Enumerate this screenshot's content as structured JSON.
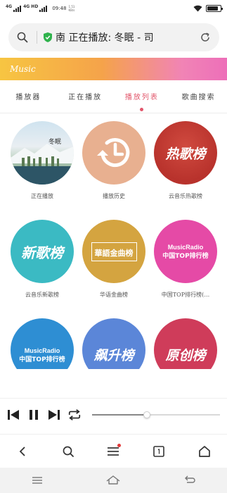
{
  "status_bar": {
    "network1": "4G",
    "network2": "4G HD",
    "time": "09:48",
    "speed_value": "1.51",
    "speed_unit": "KB/s"
  },
  "address_bar": {
    "url_text": "南 正在播放: 冬眠 - 司"
  },
  "banner": {
    "label": "Music"
  },
  "tabs": [
    {
      "label": "播放器",
      "active": false
    },
    {
      "label": "正在播放",
      "active": false
    },
    {
      "label": "播放列表",
      "active": true
    },
    {
      "label": "歌曲搜索",
      "active": false
    }
  ],
  "playlists": [
    {
      "caption": "正在播放",
      "art_text": "冬眠"
    },
    {
      "caption": "播放历史",
      "art_text": ""
    },
    {
      "caption": "云音乐热歌榜",
      "art_text": "热歌榜"
    },
    {
      "caption": "云音乐新歌榜",
      "art_text": "新歌榜"
    },
    {
      "caption": "华语金曲榜",
      "art_text": "華語金曲榜"
    },
    {
      "caption": "中国TOP排行榜(…",
      "art_text_top": "MusicRadio",
      "art_text_bottom": "中国TOP排行榜"
    },
    {
      "caption": "",
      "art_text_top": "MusicRadio",
      "art_text_bottom": "中国TOP排行榜"
    },
    {
      "caption": "",
      "art_text": "飙升榜"
    },
    {
      "caption": "",
      "art_text": "原创榜"
    }
  ],
  "player": {
    "progress_fraction": 0.43
  },
  "colors": {
    "accent": "#e2566b",
    "banner_start": "#f7c542",
    "banner_end": "#ed6fb9"
  }
}
